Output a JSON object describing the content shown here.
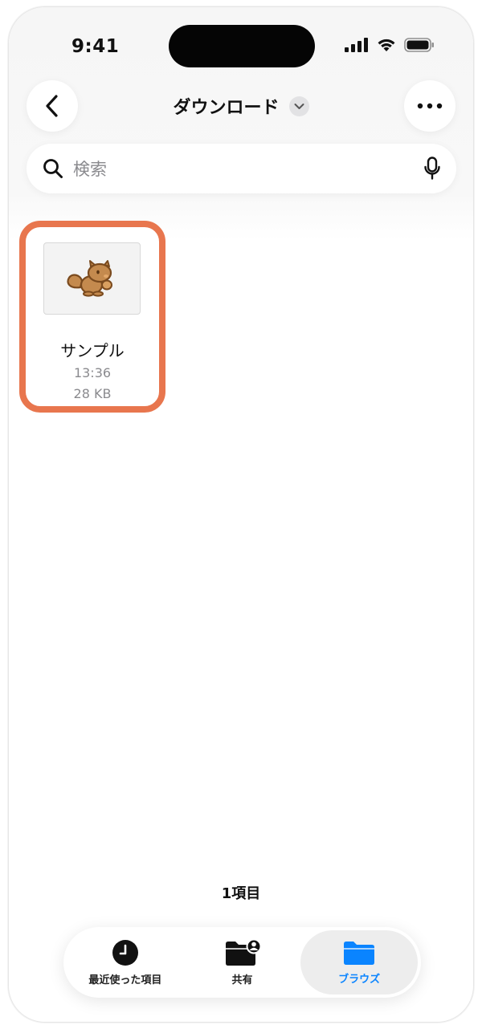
{
  "status_bar": {
    "time": "9:41"
  },
  "header": {
    "title": "ダウンロード",
    "back_icon": "chevron-left-icon",
    "more_icon": "ellipsis-icon",
    "title_menu_icon": "chevron-down-icon"
  },
  "search": {
    "placeholder": "検索",
    "search_icon": "magnifier-icon",
    "mic_icon": "microphone-icon"
  },
  "files": [
    {
      "name": "サンプル",
      "time": "13:36",
      "size": "28 KB",
      "thumbnail": "squirrel-illustration",
      "highlighted": true
    }
  ],
  "footer": {
    "item_count": "1項目"
  },
  "tabbar": {
    "tabs": [
      {
        "label": "最近使った項目",
        "icon": "clock-icon",
        "active": false
      },
      {
        "label": "共有",
        "icon": "shared-folder-icon",
        "active": false
      },
      {
        "label": "ブラウズ",
        "icon": "folder-icon",
        "active": true
      }
    ]
  },
  "colors": {
    "accent": "#0a84ff",
    "highlight_border": "#e8764e",
    "squirrel_body": "#c48a4e",
    "squirrel_outline": "#7a4a1e"
  }
}
